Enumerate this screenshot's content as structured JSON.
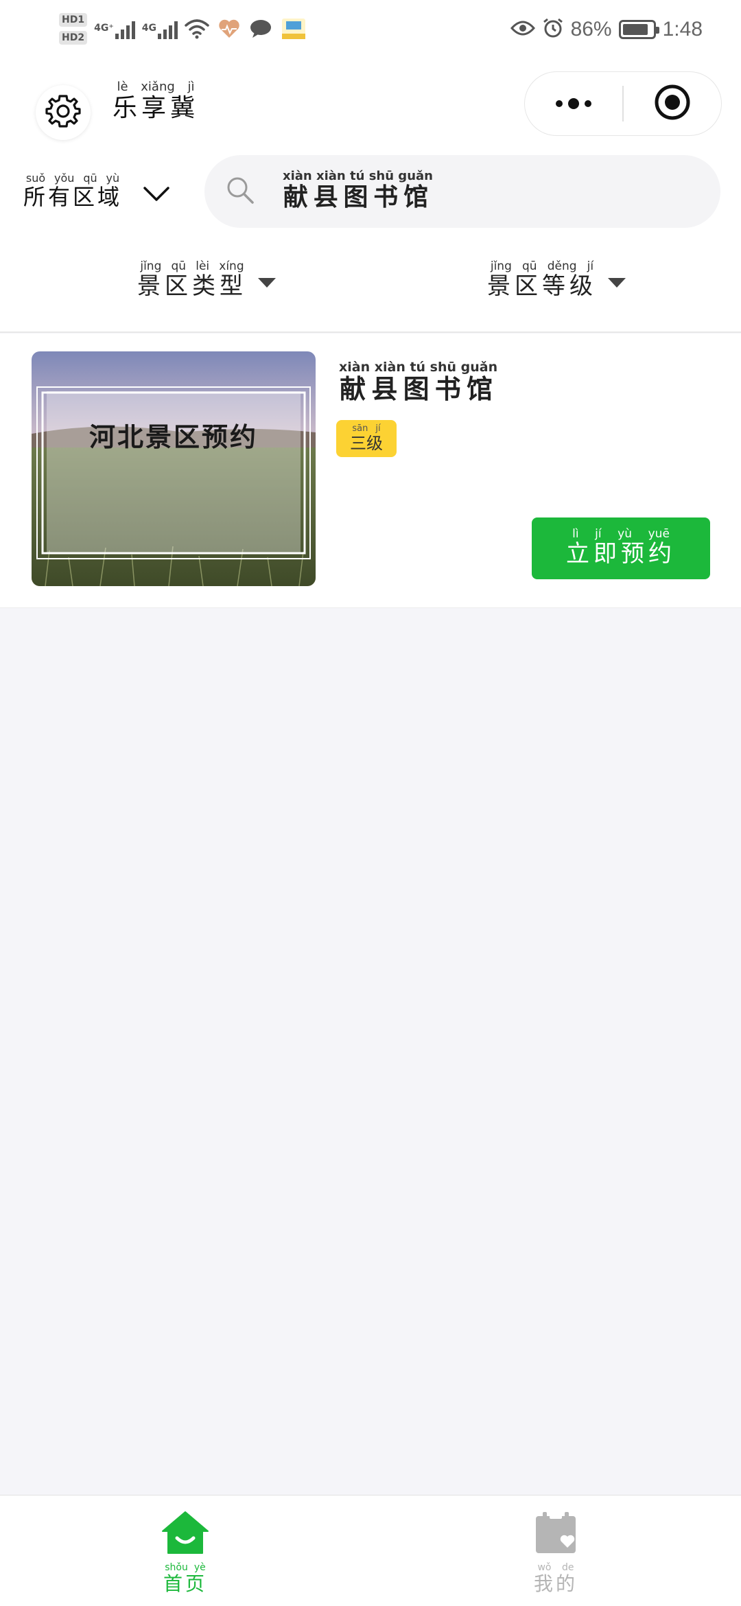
{
  "status_bar": {
    "hd1": "HD1",
    "hd2": "HD2",
    "net1": "4G⁺",
    "net2": "4G",
    "battery_percent": "86%",
    "battery_level": 0.86,
    "time": "1:48",
    "icons": [
      "wifi-icon",
      "health-heart-icon",
      "message-bubble-icon",
      "app-badge-icon",
      "eye-icon",
      "alarm-icon",
      "battery-icon"
    ]
  },
  "header": {
    "title": "乐享冀",
    "title_pinyin": "lè xiǎng jì",
    "settings_icon": "gear-icon",
    "capsule_more_icon": "more-dots-icon",
    "capsule_close_icon": "target-close-icon"
  },
  "region": {
    "label": "所有区域",
    "pinyin": "suǒ yǒu qū yù",
    "icon": "chevron-down-icon"
  },
  "search": {
    "value": "献县图书馆",
    "pinyin": "xiàn xiàn tú shū guǎn",
    "icon": "search-icon"
  },
  "filters": [
    {
      "label": "景区类型",
      "pinyin": "jǐng qū lèi xíng"
    },
    {
      "label": "景区等级",
      "pinyin": "jǐng qū děng jí"
    }
  ],
  "results": [
    {
      "image_caption": "河北景区预约",
      "name": "献县图书馆",
      "name_pinyin": "xiàn xiàn tú shū guǎn",
      "level": "三级",
      "level_pinyin": "sān jí",
      "book_label": "立即预约",
      "book_pinyin": "lì jí yù yuē"
    }
  ],
  "tabbar": {
    "tabs": [
      {
        "label": "首页",
        "pinyin": "shǒu yè",
        "icon": "home-icon",
        "active": true,
        "color": "#1cb83b"
      },
      {
        "label": "我的",
        "pinyin": "wǒ de",
        "icon": "profile-calendar-icon",
        "active": false,
        "color": "#b5b5b5"
      }
    ]
  },
  "colors": {
    "accent_green": "#1cb83b",
    "badge_yellow": "#fcd233",
    "page_bg": "#f5f5f9"
  }
}
